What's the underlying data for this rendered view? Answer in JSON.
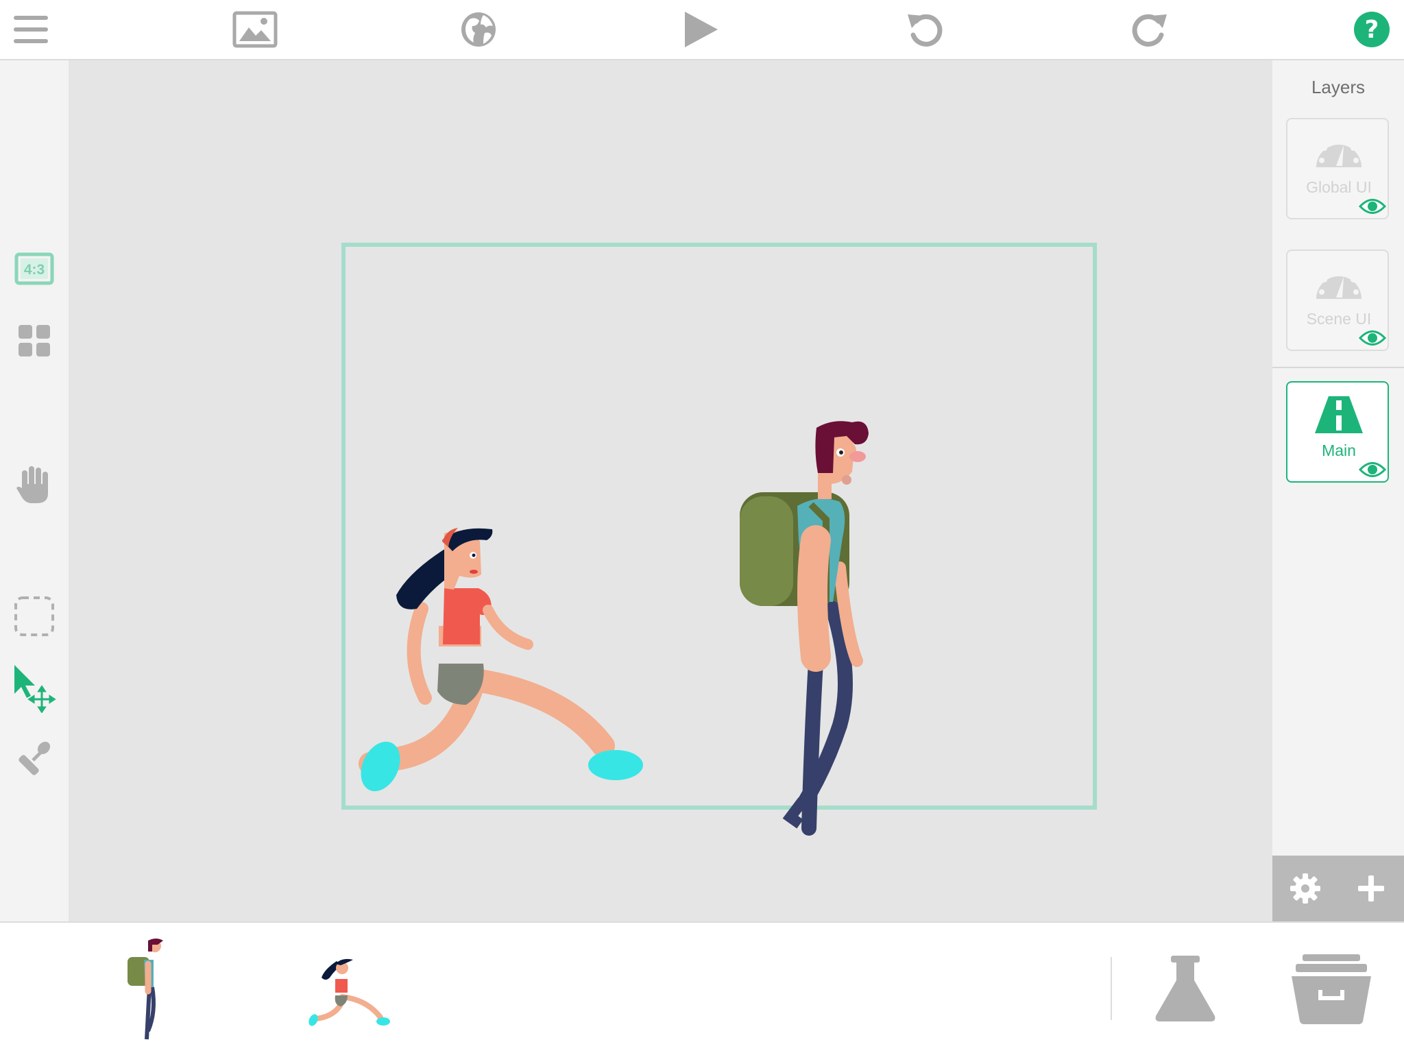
{
  "toolbar": {
    "items": [
      {
        "name": "menu",
        "icon": "hamburger-menu-icon"
      },
      {
        "name": "background",
        "icon": "image-icon"
      },
      {
        "name": "world",
        "icon": "globe-icon"
      },
      {
        "name": "play",
        "icon": "play-icon"
      },
      {
        "name": "undo",
        "icon": "undo-icon"
      },
      {
        "name": "redo",
        "icon": "redo-icon"
      },
      {
        "name": "help",
        "icon": "help-icon",
        "label": "?"
      }
    ]
  },
  "left_tools": {
    "aspect_ratio_label": "4:3",
    "tools": [
      "aspect-ratio",
      "grid",
      "pan",
      "select-area",
      "move-select",
      "stamp"
    ],
    "active_tool": "move-select"
  },
  "stage": {
    "characters": [
      "running-woman",
      "backpacker-man"
    ]
  },
  "layers_panel": {
    "title": "Layers",
    "layers": [
      {
        "label": "Global UI",
        "icon": "speedometer-icon",
        "visible": true,
        "active": false
      },
      {
        "label": "Scene UI",
        "icon": "speedometer-icon",
        "visible": true,
        "active": false
      },
      {
        "label": "Main",
        "icon": "road-icon",
        "visible": true,
        "active": true
      }
    ],
    "actions": [
      "settings",
      "add"
    ]
  },
  "library": {
    "items": [
      "backpacker-man",
      "running-woman"
    ],
    "actions": [
      "lab-flask",
      "storage-box"
    ]
  },
  "colors": {
    "accent": "#1db47a",
    "frame": "#a5dccb",
    "icon_gray": "#b0b0b0",
    "canvas": "#e5e5e5"
  }
}
